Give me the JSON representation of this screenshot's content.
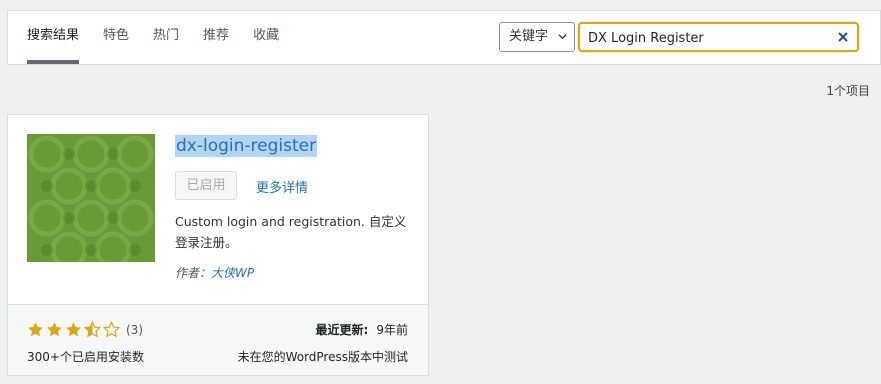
{
  "tabs": [
    {
      "label": "搜索结果",
      "current": true
    },
    {
      "label": "特色"
    },
    {
      "label": "热门"
    },
    {
      "label": "推荐"
    },
    {
      "label": "收藏"
    }
  ],
  "search": {
    "type_label": "关键字",
    "value": "DX Login Register"
  },
  "results_count": "1个项目",
  "plugin": {
    "name": "dx-login-register",
    "status_button": "已启用",
    "more_details": "更多详情",
    "description": "Custom login and registration. 自定义登录注册。",
    "author_prefix": "作者：",
    "author_name": "大侠WP",
    "rating": 3.5,
    "rating_count": "(3)",
    "installs": "300+个已启用安装数",
    "last_updated_label": "最近更新:",
    "last_updated_value": "9年前",
    "compatibility": "未在您的WordPress版本中测试"
  },
  "colors": {
    "accent": "#2271b1",
    "star": "#dba617",
    "focus_border": "#dba617",
    "thumbnail": "#6a9a35"
  }
}
